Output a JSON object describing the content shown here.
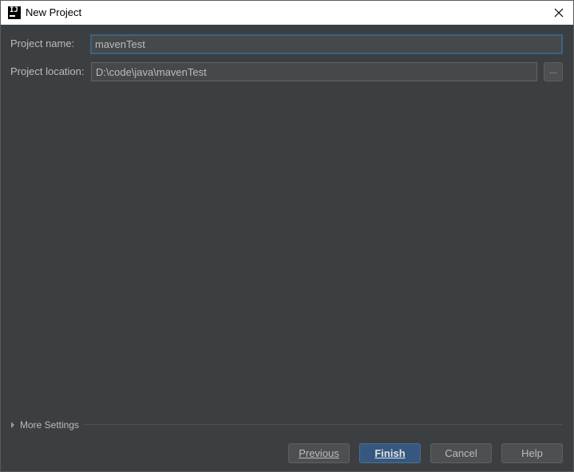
{
  "window": {
    "title": "New Project",
    "logo_text": "IJ"
  },
  "form": {
    "project_name_label": "Project name:",
    "project_name_value": "mavenTest",
    "project_location_label": "Project location:",
    "project_location_value": "D:\\code\\java\\mavenTest",
    "browse_label": "..."
  },
  "more_settings": {
    "label": "More Settings"
  },
  "buttons": {
    "previous": "Previous",
    "finish": "Finish",
    "cancel": "Cancel",
    "help": "Help"
  },
  "colors": {
    "background": "#3c3f41",
    "field": "#45494a",
    "focus_border": "#3d6185",
    "primary_button": "#365880",
    "text": "#bbbbbb"
  }
}
